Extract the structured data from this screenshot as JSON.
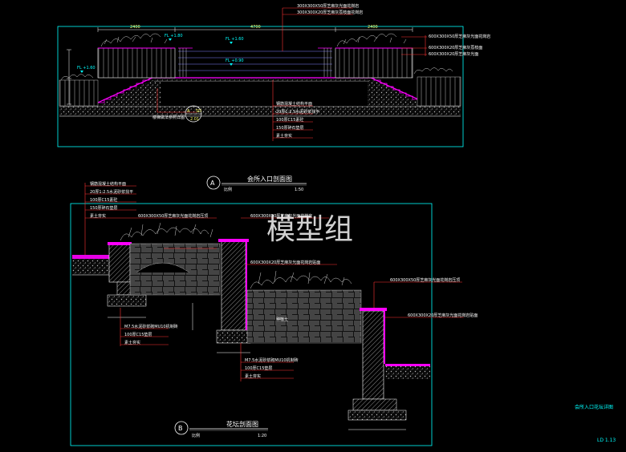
{
  "drawing_a": {
    "marker": "A",
    "title": "会所入口剖面图",
    "scale_label": "比例",
    "scale": "1:50",
    "elev_labels": [
      "FL +1.80",
      "FL +1.60",
      "FL +0.90"
    ],
    "top_notes": [
      "300X300X50厚芝麻灰光面花岗岩",
      "300X300X20厚芝麻灰荔枝面花岗岩"
    ],
    "right_notes": [
      "600X300X50厚芝麻灰光面花岗岩",
      "600X300X20厚芝麻灰荔枝面",
      "600X300X20厚芝麻灰光面"
    ],
    "bottom_notes": [
      "钢筋混凝土结构平面",
      "20厚1:2.5水泥砂浆找平",
      "100厚C15素砼",
      "150厚碎石垫层",
      "素土夯实"
    ],
    "left_note": "楼梯做法参照详图",
    "detail_ref": [
      "A",
      "SD",
      "2.01"
    ],
    "dims": [
      "2400",
      "4700",
      "2400"
    ]
  },
  "drawing_b": {
    "marker": "B",
    "title": "花坛剖面图",
    "scale_label": "比例",
    "scale": "1:20",
    "left_notes": [
      "钢筋混凝土结构平面",
      "20厚1:2.5水泥砂浆找平",
      "100厚C15素砼",
      "150厚碎石垫层",
      "素土夯实"
    ],
    "lower_notes_1": [
      "M7.5水泥砂浆砌MU10机制砖",
      "100厚C15垫层",
      "素土夯实"
    ],
    "lower_notes_2": [
      "M7.5水泥砂浆砌MU10机制砖",
      "100厚C15垫层",
      "素土夯实"
    ],
    "wall_notes": [
      "600X300X50厚芝麻灰光面花岗岩压顶",
      "600X300X50厚芝麻灰光面花岗岩",
      "600X300X20厚芝麻灰光面花岗岩贴面"
    ],
    "right_notes": [
      "600X300X50厚芝麻灰光面花岗岩压顶",
      "600X300X20厚芝麻灰光面花岗岩贴面"
    ],
    "soil_label": "种植土"
  },
  "watermark": "模型组",
  "sheet_title": "会所入口花坛详图",
  "sheet_number": "LD 1.13"
}
